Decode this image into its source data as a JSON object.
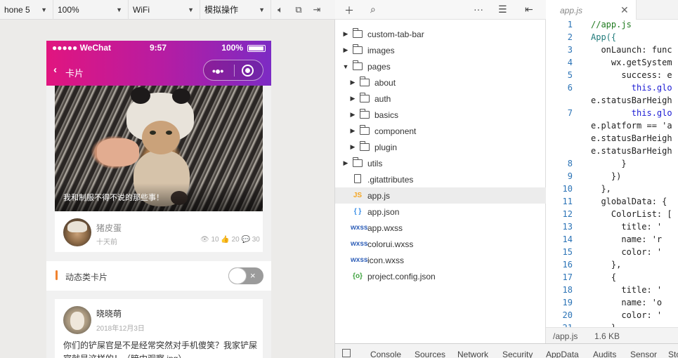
{
  "toolbar": {
    "device": "hone 5",
    "zoom": "100%",
    "network": "WiFi",
    "action": "模拟操作"
  },
  "phone": {
    "status": {
      "carrier": "●●●●● WeChat",
      "time": "9:57",
      "battery": "100%"
    },
    "nav": {
      "back": "‹",
      "title": "卡片"
    },
    "card1": {
      "caption": "我和制服不得不说的那些事！",
      "author": "猪皮蛋",
      "time": "十天前",
      "stats": "👁 10  👍 20  💬 30"
    },
    "section": {
      "label": "动态类卡片",
      "toggle_icon": "×"
    },
    "card2": {
      "author": "晓晓萌",
      "date": "2018年12月3日",
      "content": "你们的铲屎官是不是经常突然对手机傻笑？我家铲屎官就是这样的！（暗中观察.jpg）"
    }
  },
  "tree": {
    "items": [
      {
        "label": "custom-tab-bar",
        "type": "folder",
        "arrow": "▶"
      },
      {
        "label": "images",
        "type": "folder",
        "arrow": "▶"
      },
      {
        "label": "pages",
        "type": "folder",
        "arrow": "▼"
      },
      {
        "label": "about",
        "type": "folder",
        "arrow": "▶"
      },
      {
        "label": "auth",
        "type": "folder",
        "arrow": "▶"
      },
      {
        "label": "basics",
        "type": "folder",
        "arrow": "▶"
      },
      {
        "label": "component",
        "type": "folder",
        "arrow": "▶"
      },
      {
        "label": "plugin",
        "type": "folder",
        "arrow": "▶"
      },
      {
        "label": "utils",
        "type": "folder",
        "arrow": "▶"
      },
      {
        "label": ".gitattributes",
        "type": "file",
        "icon": ""
      },
      {
        "label": "app.js",
        "type": "js",
        "icon": "JS"
      },
      {
        "label": "app.json",
        "type": "json",
        "icon": "{ }"
      },
      {
        "label": "app.wxss",
        "type": "wxss",
        "icon": "wxss"
      },
      {
        "label": "colorui.wxss",
        "type": "wxss",
        "icon": "wxss"
      },
      {
        "label": "icon.wxss",
        "type": "wxss",
        "icon": "wxss"
      },
      {
        "label": "project.config.json",
        "type": "cfg",
        "icon": "{o}"
      }
    ]
  },
  "devtools": {
    "tabs": [
      "Console",
      "Sources",
      "Network",
      "Security",
      "AppData",
      "Audits",
      "Sensor",
      "Sto"
    ]
  },
  "editor": {
    "tab": "app.js",
    "lines": [
      {
        "num": "1",
        "text": "//app.js"
      },
      {
        "num": "2",
        "text": "App({"
      },
      {
        "num": "3",
        "text": "  onLaunch: func"
      },
      {
        "num": "4",
        "text": "    wx.getSystem"
      },
      {
        "num": "5",
        "text": "      success: e"
      },
      {
        "num": "6",
        "text": "        this.glo"
      },
      {
        "num": "",
        "text": "e.statusBarHeigh"
      },
      {
        "num": "7",
        "text": "        this.glo"
      },
      {
        "num": "",
        "text": "e.platform == 'a"
      },
      {
        "num": "",
        "text": "e.statusBarHeigh"
      },
      {
        "num": "",
        "text": "e.statusBarHeigh"
      },
      {
        "num": "8",
        "text": "      }"
      },
      {
        "num": "9",
        "text": "    })"
      },
      {
        "num": "10",
        "text": "  },"
      },
      {
        "num": "11",
        "text": "  globalData: {"
      },
      {
        "num": "12",
        "text": "    ColorList: ["
      },
      {
        "num": "13",
        "text": "      title: '"
      },
      {
        "num": "14",
        "text": "      name: 'r"
      },
      {
        "num": "15",
        "text": "      color: '"
      },
      {
        "num": "16",
        "text": "    },"
      },
      {
        "num": "17",
        "text": "    {"
      },
      {
        "num": "18",
        "text": "      title: '"
      },
      {
        "num": "19",
        "text": "      name: 'o"
      },
      {
        "num": "20",
        "text": "      color: '"
      },
      {
        "num": "21",
        "text": "    },"
      }
    ],
    "status_path": "/app.js",
    "status_size": "1.6 KB"
  }
}
